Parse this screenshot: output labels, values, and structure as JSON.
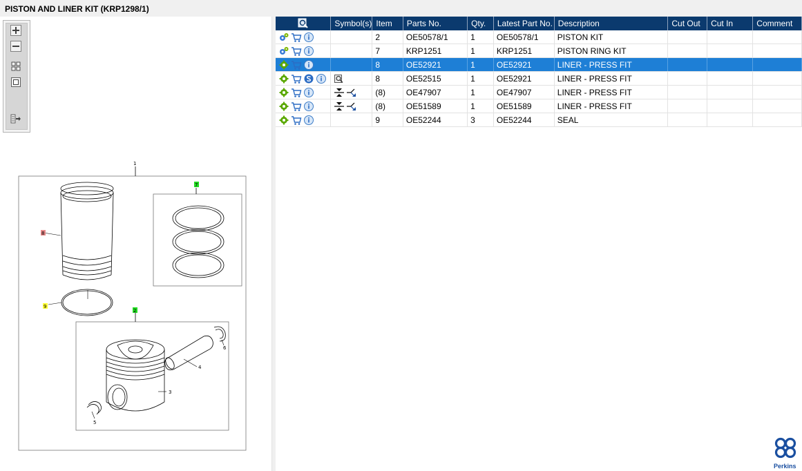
{
  "window": {
    "title": "PISTON AND LINER KIT (KRP1298/1)"
  },
  "toolbar": {
    "buttons": [
      {
        "name": "zoom-in-icon"
      },
      {
        "name": "zoom-out-icon"
      },
      {
        "name": "fit-all-icon"
      },
      {
        "name": "actual-size-icon"
      },
      {
        "name": "expand-list-icon"
      }
    ]
  },
  "diagram": {
    "callouts": {
      "c1": "1",
      "c7": "7",
      "c8": "8",
      "c9": "9",
      "c2": "2",
      "c3": "3",
      "c4": "4",
      "c5": "5",
      "c6": "6"
    },
    "highlight_colors": {
      "green": "#22dd22",
      "red": "#e98b8b",
      "yellow": "#ffff33"
    }
  },
  "table": {
    "columns": [
      "",
      "Symbol(s)",
      "Item",
      "Parts No.",
      "Qty.",
      "Latest Part No.",
      "Description",
      "Cut Out",
      "Cut In",
      "Comment"
    ],
    "rows": [
      {
        "item": "2",
        "part_no": "OE50578/1",
        "qty": "1",
        "latest": "OE50578/1",
        "desc": "PISTON KIT",
        "cut_out": "",
        "cut_in": "",
        "comment": "",
        "icons": [
          "gears-icon",
          "cart-icon",
          "info-icon"
        ],
        "symbols": []
      },
      {
        "item": "7",
        "part_no": "KRP1251",
        "qty": "1",
        "latest": "KRP1251",
        "desc": "PISTON RING KIT",
        "cut_out": "",
        "cut_in": "",
        "comment": "",
        "icons": [
          "gears-icon",
          "cart-icon",
          "info-icon"
        ],
        "symbols": []
      },
      {
        "item": "8",
        "part_no": "OE52921",
        "qty": "1",
        "latest": "OE52921",
        "desc": "LINER - PRESS FIT",
        "cut_out": "",
        "cut_in": "",
        "comment": "",
        "icons": [
          "gear-icon",
          "cart-icon",
          "info-icon"
        ],
        "symbols": [],
        "selected": true
      },
      {
        "item": "8",
        "part_no": "OE52515",
        "qty": "1",
        "latest": "OE52921",
        "desc": "LINER - PRESS FIT",
        "cut_out": "",
        "cut_in": "",
        "comment": "",
        "icons": [
          "gear-icon",
          "cart-icon",
          "supersession-icon",
          "info-icon"
        ],
        "symbols": [
          "superseded-book-icon"
        ]
      },
      {
        "item": "(8)",
        "part_no": "OE47907",
        "qty": "1",
        "latest": "OE47907",
        "desc": "LINER - PRESS FIT",
        "cut_out": "",
        "cut_in": "",
        "comment": "",
        "icons": [
          "gear-icon",
          "cart-icon",
          "info-icon"
        ],
        "symbols": [
          "press-fit-icon"
        ]
      },
      {
        "item": "(8)",
        "part_no": "OE51589",
        "qty": "1",
        "latest": "OE51589",
        "desc": "LINER - PRESS FIT",
        "cut_out": "",
        "cut_in": "",
        "comment": "",
        "icons": [
          "gear-icon",
          "cart-icon",
          "info-icon"
        ],
        "symbols": [
          "press-fit-icon"
        ]
      },
      {
        "item": "9",
        "part_no": "OE52244",
        "qty": "3",
        "latest": "OE52244",
        "desc": "SEAL",
        "cut_out": "",
        "cut_in": "",
        "comment": "",
        "icons": [
          "gear-icon",
          "cart-icon",
          "info-icon"
        ],
        "symbols": []
      }
    ]
  },
  "brand": {
    "name": "Perkins",
    "color": "#1a4fa0"
  },
  "colors": {
    "header": "#0b3a6e",
    "selected_row": "#1e7fd6"
  }
}
